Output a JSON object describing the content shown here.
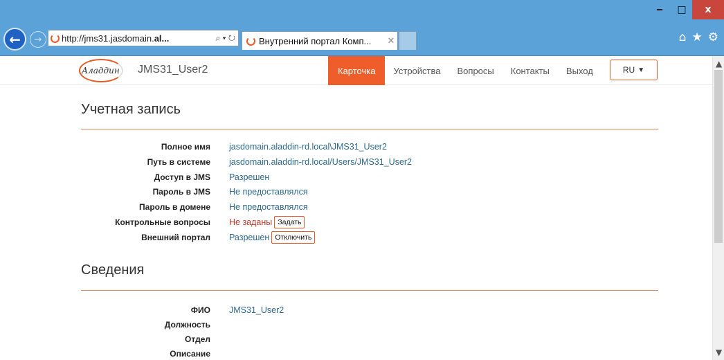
{
  "browser": {
    "url_prefix": "http://jms31.jasdomain.",
    "url_bold": "al...",
    "addr_tools": "⌕ ▾ ↻",
    "tab_title": "Внутренний портал Комп...",
    "tab_close": "✕",
    "win_min": "‒",
    "win_max": "□",
    "win_close": "x"
  },
  "portal": {
    "logo_text": "Аладдин",
    "username": "JMS31_User2",
    "menu": [
      {
        "label": "Карточка",
        "active": true
      },
      {
        "label": "Устройства"
      },
      {
        "label": "Вопросы"
      },
      {
        "label": "Контакты"
      },
      {
        "label": "Выход"
      }
    ],
    "lang": "RU"
  },
  "account": {
    "title": "Учетная запись",
    "rows": [
      {
        "label": "Полное имя",
        "value": "jasdomain.aladdin-rd.local\\JMS31_User2"
      },
      {
        "label": "Путь в системе",
        "value": "jasdomain.aladdin-rd.local/Users/JMS31_User2"
      },
      {
        "label": "Доступ в JMS",
        "value": "Разрешен"
      },
      {
        "label": "Пароль в JMS",
        "value": "Не предоставлялся"
      },
      {
        "label": "Пароль в домене",
        "value": "Не предоставлялся"
      },
      {
        "label": "Контрольные вопросы",
        "value": "Не заданы",
        "button": "Задать"
      },
      {
        "label": "Внешний портал",
        "value": "Разрешен",
        "button": "Отключить"
      }
    ]
  },
  "info": {
    "title": "Сведения",
    "rows": [
      {
        "label": "ФИО",
        "value": "JMS31_User2"
      },
      {
        "label": "Должность",
        "value": ""
      },
      {
        "label": "Отдел",
        "value": ""
      },
      {
        "label": "Описание",
        "value": ""
      }
    ]
  },
  "colors": {
    "accent": "#ee5d2a",
    "link": "#2e6a8e",
    "warning": "#c0392b",
    "chrome": "#5aa2d8"
  }
}
